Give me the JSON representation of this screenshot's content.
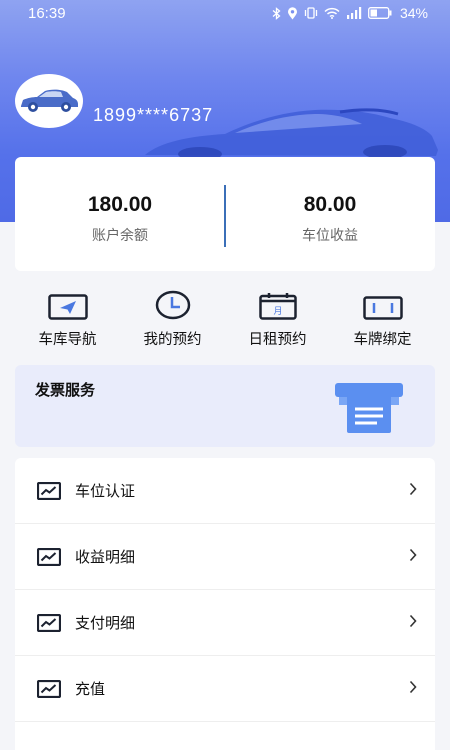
{
  "status_bar": {
    "time": "16:39",
    "battery": "34%",
    "icons": [
      "bluetooth-icon",
      "location-icon",
      "vibrate-icon",
      "wifi-icon",
      "signal-icon",
      "battery-icon"
    ]
  },
  "profile": {
    "phone": "1899****6737"
  },
  "balance": {
    "account_value": "180.00",
    "account_label": "账户余额",
    "parking_value": "80.00",
    "parking_label": "车位收益"
  },
  "quick_actions": [
    {
      "label": "车库导航",
      "icon": "navigation-icon"
    },
    {
      "label": "我的预约",
      "icon": "clock-icon"
    },
    {
      "label": "日租预约",
      "icon": "calendar-icon"
    },
    {
      "label": "车牌绑定",
      "icon": "license-plate-icon"
    }
  ],
  "invoice": {
    "title": "发票服务",
    "icon": "invoice-printer-icon"
  },
  "menu": [
    {
      "label": "车位认证",
      "icon": "chart-icon"
    },
    {
      "label": "收益明细",
      "icon": "chart-icon"
    },
    {
      "label": "支付明细",
      "icon": "chart-icon"
    },
    {
      "label": "充值",
      "icon": "chart-icon"
    }
  ],
  "colors": {
    "header_gradient_top": "#8fa3f1",
    "header_gradient_bottom": "#4f6ae6",
    "accent": "#3b6fb8",
    "icon_dark": "#1c2230",
    "invoice_bg": "#e9ecfb",
    "invoice_icon": "#5b8ff0"
  }
}
